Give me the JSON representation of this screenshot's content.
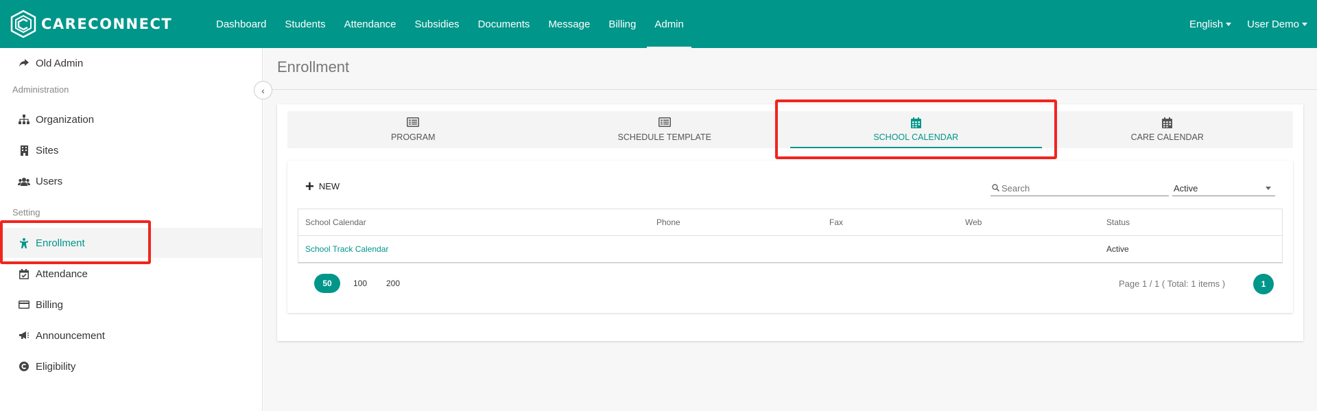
{
  "brand": {
    "name": "CARECONNECT"
  },
  "nav": {
    "items": [
      {
        "label": "Dashboard"
      },
      {
        "label": "Students"
      },
      {
        "label": "Attendance"
      },
      {
        "label": "Subsidies"
      },
      {
        "label": "Documents"
      },
      {
        "label": "Message"
      },
      {
        "label": "Billing"
      },
      {
        "label": "Admin"
      }
    ],
    "active": "Admin",
    "language": "English",
    "user": "User Demo"
  },
  "sidebar": {
    "old_admin": "Old Admin",
    "section_admin": "Administration",
    "organization": "Organization",
    "sites": "Sites",
    "users": "Users",
    "section_setting": "Setting",
    "enrollment": "Enrollment",
    "attendance": "Attendance",
    "billing": "Billing",
    "announcement": "Announcement",
    "eligibility": "Eligibility"
  },
  "page": {
    "title": "Enrollment"
  },
  "tabs": [
    {
      "label": "PROGRAM",
      "icon": "list-icon"
    },
    {
      "label": "SCHEDULE TEMPLATE",
      "icon": "list-icon"
    },
    {
      "label": "SCHOOL CALENDAR",
      "icon": "calendar-icon"
    },
    {
      "label": "CARE CALENDAR",
      "icon": "calendar-icon"
    }
  ],
  "active_tab": "SCHOOL CALENDAR",
  "toolbar": {
    "new_label": "NEW",
    "search_placeholder": "Search",
    "status_filter": "Active"
  },
  "table": {
    "headers": [
      "School Calendar",
      "Phone",
      "Fax",
      "Web",
      "Status"
    ],
    "rows": [
      {
        "name": "School Track Calendar",
        "phone": "",
        "fax": "",
        "web": "",
        "status": "Active"
      }
    ]
  },
  "pagination": {
    "sizes": [
      "50",
      "100",
      "200"
    ],
    "active_size": "50",
    "info": "Page 1 / 1 ( Total: 1 items )",
    "current_page": "1"
  },
  "colors": {
    "brand": "#00968a",
    "annotation": "#f0251e"
  }
}
